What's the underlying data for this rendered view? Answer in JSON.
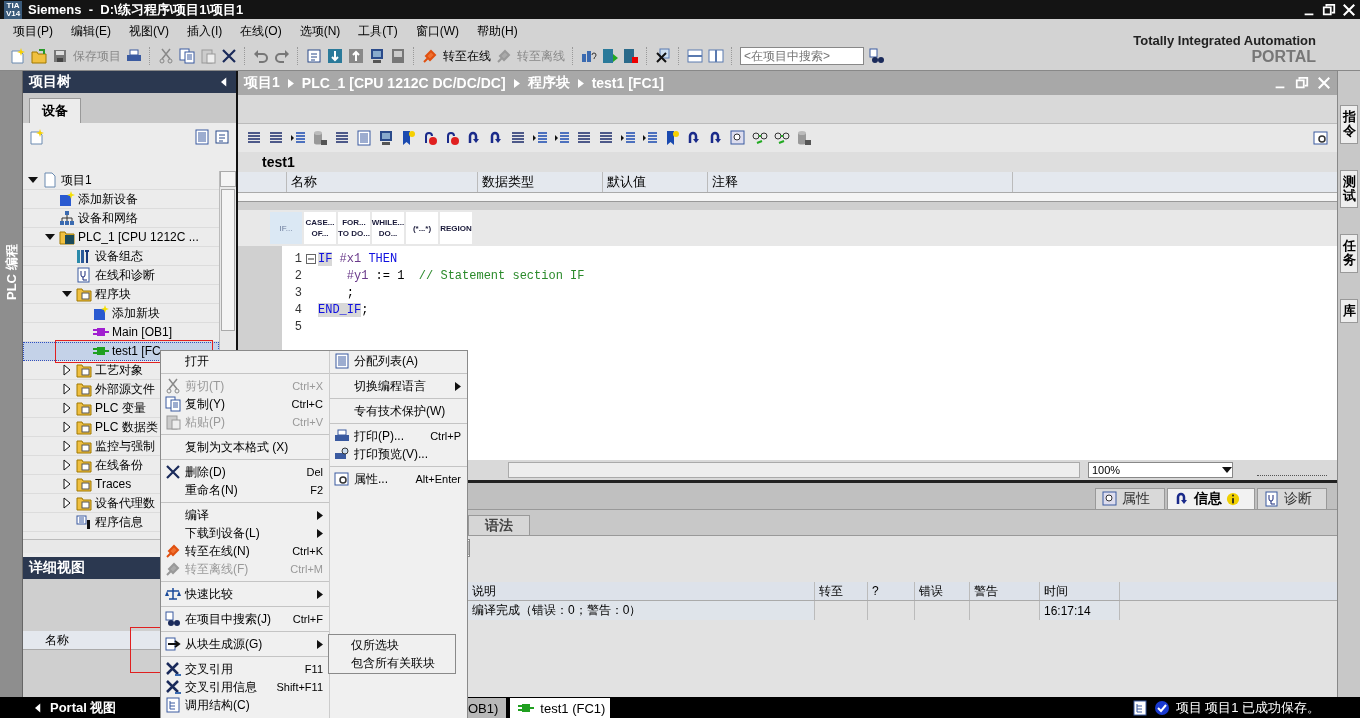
{
  "title_bar": {
    "logo": [
      "TIA",
      "V14"
    ],
    "title": "Siemens  -  D:\\练习程序\\项目1\\项目1"
  },
  "menu_bar": [
    "项目(P)",
    "编辑(E)",
    "视图(V)",
    "插入(I)",
    "在线(O)",
    "选项(N)",
    "工具(T)",
    "窗口(W)",
    "帮助(H)"
  ],
  "toolbar": {
    "save_label": "保存项目",
    "online_label": "转至在线",
    "offline_label": "转至离线",
    "search": {
      "placeholder": "<在项目中搜索>"
    }
  },
  "brand": {
    "line1": "Totally Integrated Automation",
    "line2": "PORTAL"
  },
  "side_tab": "PLC 编程",
  "project_tree": {
    "title": "项目树",
    "tab": "设备",
    "items": [
      {
        "label": "项目1",
        "expanded": true,
        "selected": false,
        "children": [
          {
            "label": "添加新设备",
            "selected": false
          },
          {
            "label": "设备和网络",
            "selected": false
          },
          {
            "label": "PLC_1 [CPU 1212C ...",
            "expanded": true,
            "selected": false,
            "children": [
              {
                "label": "设备组态",
                "selected": false
              },
              {
                "label": "在线和诊断",
                "selected": false
              },
              {
                "label": "程序块",
                "expanded": true,
                "selected": false,
                "children": [
                  {
                    "label": "添加新块",
                    "selected": false
                  },
                  {
                    "label": "Main [OB1]",
                    "selected": false
                  },
                  {
                    "label": "test1 [FC",
                    "selected": true
                  }
                ]
              },
              {
                "label": "工艺对象",
                "expanded": false,
                "selected": false
              },
              {
                "label": "外部源文件",
                "expanded": false,
                "selected": false
              },
              {
                "label": "PLC 变量",
                "expanded": false,
                "selected": false
              },
              {
                "label": "PLC 数据类",
                "expanded": false,
                "selected": false
              },
              {
                "label": "监控与强制",
                "expanded": false,
                "selected": false
              },
              {
                "label": "在线备份",
                "expanded": false,
                "selected": false
              },
              {
                "label": "Traces",
                "expanded": false,
                "selected": false
              },
              {
                "label": "设备代理数",
                "expanded": false,
                "selected": false
              },
              {
                "label": "程序信息",
                "selected": false
              }
            ]
          }
        ]
      }
    ]
  },
  "detail_view": {
    "title": "详细视图",
    "columns": [
      "名称"
    ]
  },
  "editor": {
    "breadcrumb": [
      "项目1",
      "PLC_1 [CPU 1212C DC/DC/DC]",
      "程序块",
      "test1 [FC1]"
    ],
    "block_title": "test1",
    "interface_columns": [
      "名称",
      "数据类型",
      "默认值",
      "注释"
    ],
    "instructions": [
      {
        "lines": [
          "IF..."
        ],
        "selected": true
      },
      {
        "lines": [
          "CASE...",
          "OF..."
        ],
        "selected": false
      },
      {
        "lines": [
          "FOR...",
          "TO DO..."
        ],
        "selected": false
      },
      {
        "lines": [
          "WHILE...",
          "DO..."
        ],
        "selected": false
      },
      {
        "lines": [
          "(*...*)"
        ],
        "selected": false
      },
      {
        "lines": [
          "REGION"
        ],
        "selected": false
      }
    ],
    "code": [
      {
        "number": "1",
        "foldable": true,
        "tokens": [
          {
            "kind": "match",
            "text": "IF"
          },
          {
            "kind": "variable",
            "text": " #x1 "
          },
          {
            "kind": "keyword",
            "text": "THEN"
          }
        ]
      },
      {
        "number": "2",
        "foldable": false,
        "tokens": [
          {
            "kind": "variable",
            "text": "    #y1 "
          },
          {
            "kind": "plain",
            "text": ":= 1  "
          },
          {
            "kind": "comment",
            "text": "// Statement section IF"
          }
        ]
      },
      {
        "number": "3",
        "foldable": false,
        "tokens": [
          {
            "kind": "plain",
            "text": "    ;"
          }
        ]
      },
      {
        "number": "4",
        "foldable": false,
        "tokens": [
          {
            "kind": "match",
            "text": "END_IF"
          },
          {
            "kind": "plain",
            "text": ";"
          }
        ]
      },
      {
        "number": "5",
        "foldable": false
      }
    ],
    "zoom": {
      "value": "100%"
    }
  },
  "inspector": {
    "tabs": [
      {
        "label": "属性",
        "selected": false
      },
      {
        "label": "信息",
        "selected": true
      },
      {
        "label": "诊断",
        "selected": false
      }
    ],
    "subtabs": [
      {
        "label": "语法",
        "selected": false
      }
    ],
    "columns": [
      "说明",
      "转至",
      "?",
      "错误",
      "警告",
      "时间"
    ],
    "rows": [
      {
        "cells": [
          "编译完成（错误：0；警告：0）",
          "",
          "",
          "",
          "",
          "16:17:14"
        ]
      }
    ]
  },
  "right_tabs": [
    "指令",
    "测试",
    "任务",
    "库"
  ],
  "status_bar": {
    "portal_view": "Portal 视图",
    "editor_tabs": [
      {
        "label": "OB1)",
        "selected": false
      },
      {
        "label": "test1 (FC1)",
        "selected": true
      }
    ],
    "message": "项目 项目1 已成功保存。"
  },
  "context_menu": {
    "columns": [
      [
        {
          "label": "打开",
          "disabled": false,
          "separator_before": false
        },
        {
          "label": "剪切(T)",
          "shortcut": "Ctrl+X",
          "disabled": true,
          "separator_before": true
        },
        {
          "label": "复制(Y)",
          "shortcut": "Ctrl+C",
          "disabled": false,
          "separator_before": false
        },
        {
          "label": "粘贴(P)",
          "shortcut": "Ctrl+V",
          "disabled": true,
          "separator_before": false
        },
        {
          "label": "复制为文本格式 (X)",
          "disabled": false,
          "separator_before": true
        },
        {
          "label": "删除(D)",
          "shortcut": "Del",
          "disabled": false,
          "separator_before": true
        },
        {
          "label": "重命名(N)",
          "shortcut": "F2",
          "disabled": false,
          "separator_before": false
        },
        {
          "label": "编译",
          "submenu": true,
          "disabled": false,
          "separator_before": true
        },
        {
          "label": "下载到设备(L)",
          "submenu": true,
          "disabled": false,
          "separator_before": false
        },
        {
          "label": "转至在线(N)",
          "shortcut": "Ctrl+K",
          "disabled": false,
          "separator_before": false
        },
        {
          "label": "转至离线(F)",
          "shortcut": "Ctrl+M",
          "disabled": true,
          "separator_before": false
        },
        {
          "label": "快速比较",
          "submenu": true,
          "disabled": false,
          "separator_before": true
        },
        {
          "label": "在项目中搜索(J)",
          "shortcut": "Ctrl+F",
          "disabled": false,
          "separator_before": true
        },
        {
          "label": "从块生成源(G)",
          "submenu": true,
          "disabled": false,
          "separator_before": true
        },
        {
          "label": "交叉引用",
          "shortcut": "F11",
          "disabled": false,
          "separator_before": true
        },
        {
          "label": "交叉引用信息",
          "shortcut": "Shift+F11",
          "disabled": false,
          "separator_before": false
        },
        {
          "label": "调用结构(C)",
          "disabled": false,
          "separator_before": false
        }
      ],
      [
        {
          "label": "分配列表(A)",
          "disabled": false,
          "separator_before": false
        },
        {
          "label": "切换编程语言",
          "submenu": true,
          "disabled": false,
          "separator_before": true
        },
        {
          "label": "专有技术保护(W)",
          "disabled": false,
          "separator_before": true
        },
        {
          "label": "打印(P)...",
          "shortcut": "Ctrl+P",
          "disabled": false,
          "separator_before": true
        },
        {
          "label": "打印预览(V)...",
          "disabled": false,
          "separator_before": false
        },
        {
          "label": "属性...",
          "shortcut": "Alt+Enter",
          "disabled": false,
          "separator_before": true
        }
      ]
    ],
    "submenu": [
      "仅所选块",
      "包含所有关联块"
    ]
  }
}
